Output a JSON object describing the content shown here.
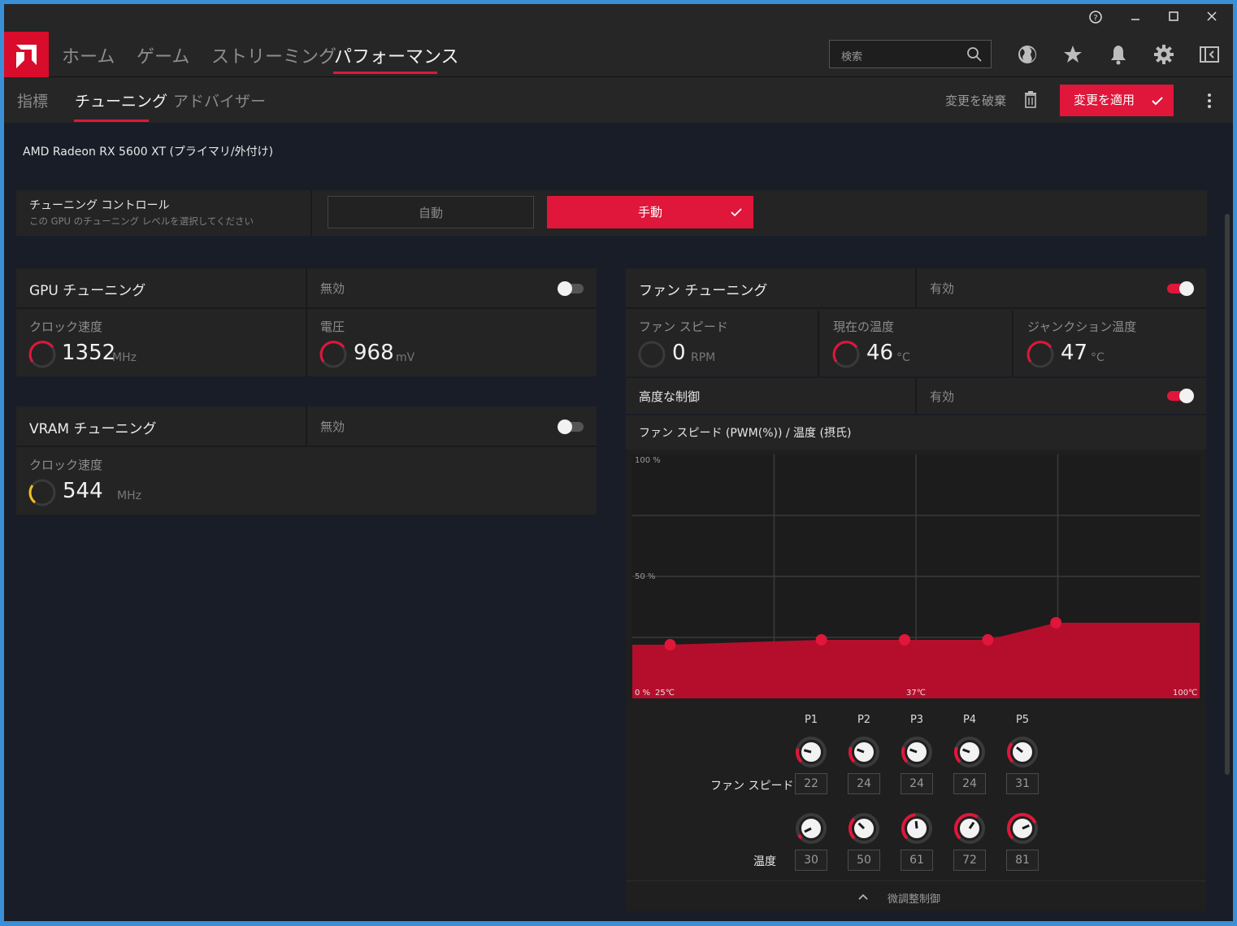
{
  "nav": {
    "items": [
      "ホーム",
      "ゲーム",
      "ストリーミング",
      "パフォーマンス"
    ],
    "search_placeholder": "検索"
  },
  "subnav": {
    "items": [
      "指標",
      "チューニング",
      "アドバイザー"
    ],
    "discard_label": "変更を破棄",
    "apply_label": "変更を適用"
  },
  "gpu_name": "AMD Radeon RX 5600 XT (プライマリ/外付け)",
  "tuning_control": {
    "title": "チューニング コントロール",
    "subtitle": "この GPU のチューニング レベルを選択してください",
    "auto_label": "自動",
    "manual_label": "手動",
    "selected": "手動"
  },
  "gpu_tuning": {
    "title": "GPU チューニング",
    "status": "無効",
    "enabled": false,
    "clock_label": "クロック速度",
    "clock_value": "1352",
    "clock_unit": "MHz",
    "voltage_label": "電圧",
    "voltage_value": "968",
    "voltage_unit": "mV"
  },
  "vram_tuning": {
    "title": "VRAM チューニング",
    "status": "無効",
    "enabled": false,
    "clock_label": "クロック速度",
    "clock_value": "544",
    "clock_unit": "MHz"
  },
  "fan_tuning": {
    "title": "ファン チューニング",
    "status": "有効",
    "enabled": true,
    "fan_speed_label": "ファン スピード",
    "fan_speed_value": "0",
    "fan_speed_unit": "RPM",
    "temp_label": "現在の温度",
    "temp_value": "46",
    "temp_unit": "°C",
    "junction_label": "ジャンクション温度",
    "junction_value": "47",
    "junction_unit": "°C",
    "advanced_label": "高度な制御",
    "advanced_status": "有効",
    "advanced_enabled": true,
    "chart_title": "ファン スピード (PWM(%)) / 温度 (摂氏)",
    "fan_speed_row_label": "ファン スピード",
    "temp_row_label": "温度",
    "fine_tune_label": "微調整制御"
  },
  "colors": {
    "accent": "#e0163a",
    "vram_gauge": "#f0c020"
  },
  "chart_data": {
    "type": "area",
    "title": "ファン スピード (PWM(%)) / 温度 (摂氏)",
    "points": [
      "P1",
      "P2",
      "P3",
      "P4",
      "P5"
    ],
    "x": [
      30,
      50,
      61,
      72,
      81
    ],
    "y": [
      22,
      24,
      24,
      24,
      31
    ],
    "y_tick_labels": [
      "100 %",
      "50 %",
      "0 %"
    ],
    "x_tick_labels": [
      "25℃",
      "37℃",
      "100℃"
    ],
    "xlim": [
      25,
      100
    ],
    "ylim": [
      0,
      100
    ],
    "grid": true
  }
}
